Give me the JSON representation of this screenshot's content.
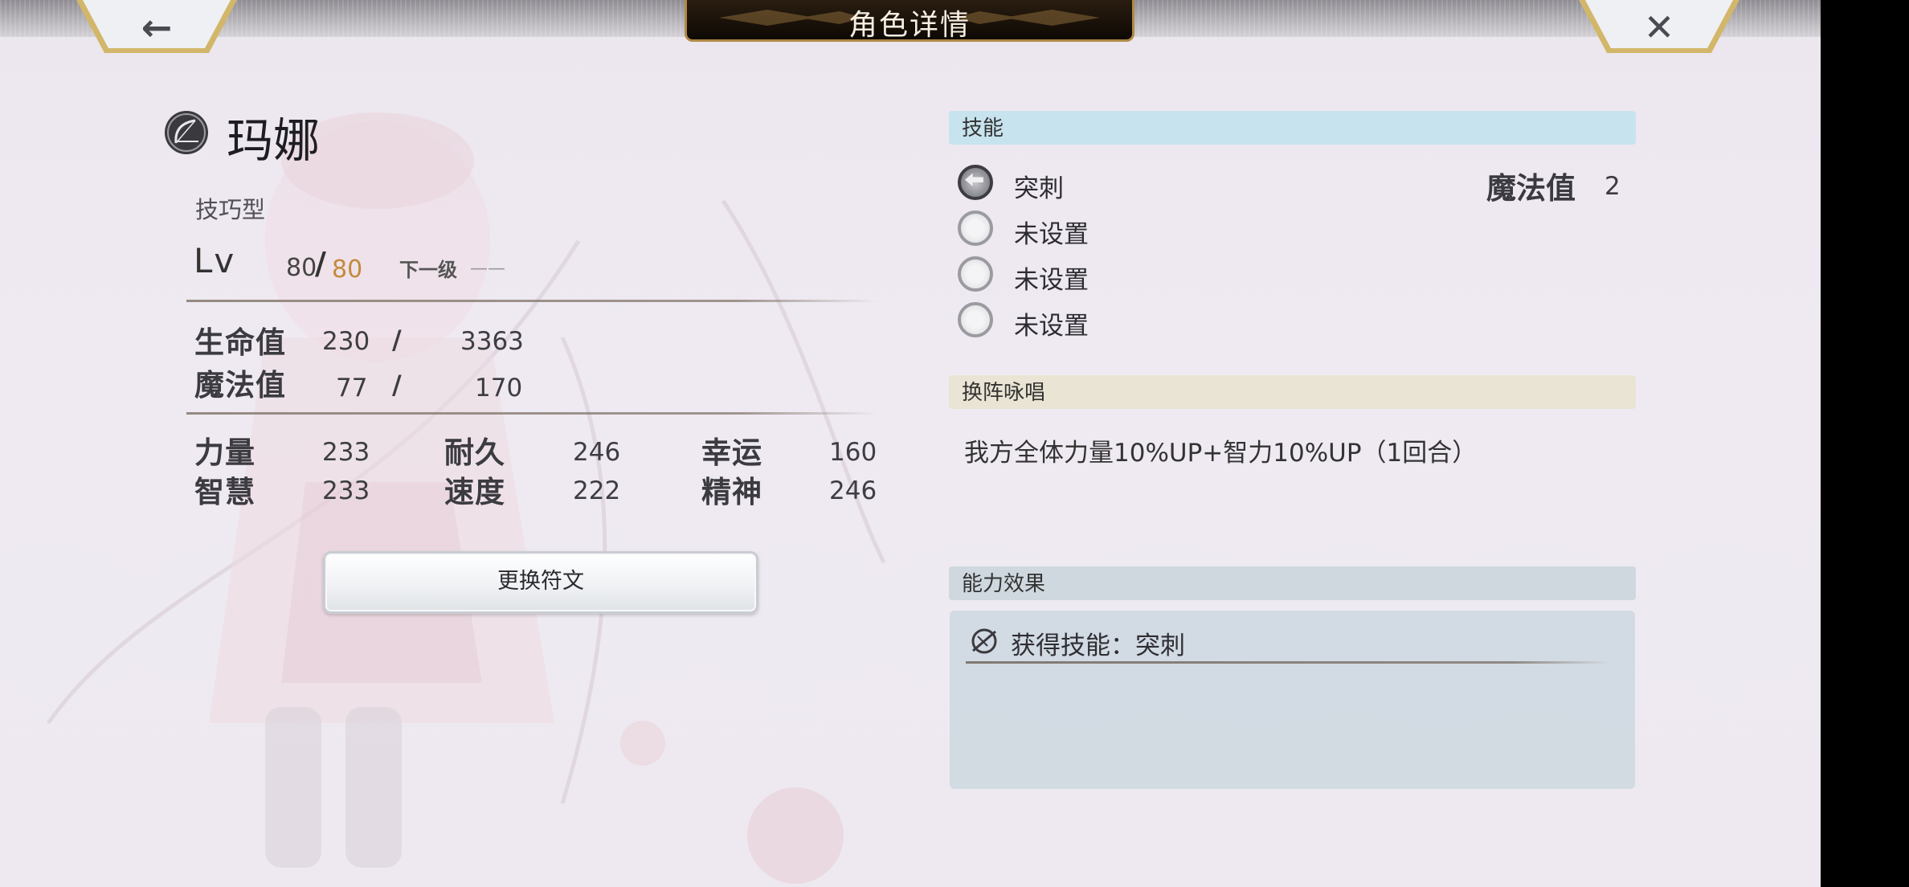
{
  "header": {
    "title": "角色详情",
    "back_icon": "←",
    "close_icon": "✕"
  },
  "character": {
    "name": "玛娜",
    "type": "技巧型",
    "class_icon": "bow-icon"
  },
  "level": {
    "label": "Lv",
    "current": "80",
    "slash": "/",
    "max": "80",
    "next_label": "下一级",
    "next_value": "——"
  },
  "vitals": {
    "hp": {
      "label": "生命值",
      "current": "230",
      "slash": "/",
      "max": "3363"
    },
    "mp": {
      "label": "魔法值",
      "current": "77",
      "slash": "/",
      "max": "170"
    }
  },
  "stats": {
    "str": {
      "label": "力量",
      "value": "233"
    },
    "int": {
      "label": "智慧",
      "value": "233"
    },
    "end": {
      "label": "耐久",
      "value": "246"
    },
    "spd": {
      "label": "速度",
      "value": "222"
    },
    "luk": {
      "label": "幸运",
      "value": "160"
    },
    "spi": {
      "label": "精神",
      "value": "246"
    }
  },
  "rune_button": "更换符文",
  "skills": {
    "header": "技能",
    "mp_label": "魔法值",
    "mp_value": "2",
    "items": [
      {
        "label": "突刺",
        "icon": "arrow-left-icon"
      },
      {
        "label": "未设置"
      },
      {
        "label": "未设置"
      },
      {
        "label": "未设置"
      }
    ]
  },
  "formation": {
    "header": "换阵咏唱",
    "text": "我方全体力量10%UP+智力10%UP（1回合）"
  },
  "ability": {
    "header": "能力效果",
    "text": "获得技能：突刺",
    "icon": "skill-learn-icon"
  },
  "colors": {
    "skill_header_bg": "#c7e3ee",
    "formation_header_bg": "#e9e4d3",
    "ability_header_bg": "#cfd8df",
    "title_plate": "#1a1109",
    "gold": "#c28a3c"
  }
}
